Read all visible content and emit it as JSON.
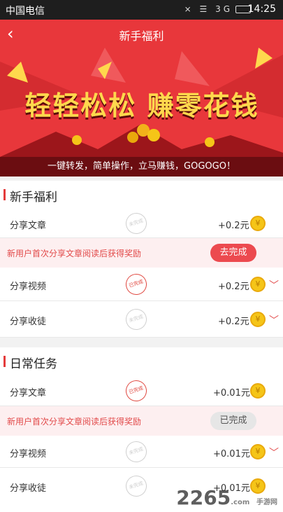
{
  "status": {
    "carrier": "中国电信",
    "icons": "⨯ ☰ 3G",
    "time": "14:25"
  },
  "header": {
    "back": "‹",
    "title": "新手福利"
  },
  "banner": {
    "slogan": "轻轻松松 赚零花钱",
    "subline": "一键转发，简单操作，立马赚钱，GOGOGO！"
  },
  "sections": {
    "newbie": {
      "title": "新手福利",
      "rows": [
        {
          "name": "分享文章",
          "reward": "+0.2元",
          "stamp": "未完成"
        },
        {
          "name": "分享视频",
          "reward": "+0.2元",
          "stamp": "已完成"
        },
        {
          "name": "分享收徒",
          "reward": "+0.2元",
          "stamp": "未完成"
        }
      ],
      "tip": {
        "text": "新用户首次分享文章阅读后获得奖励",
        "button": "去完成"
      }
    },
    "daily": {
      "title": "日常任务",
      "rows": [
        {
          "name": "分享文章",
          "reward": "+0.01元",
          "stamp": "已完成"
        },
        {
          "name": "分享视频",
          "reward": "+0.01元",
          "stamp": "未完成"
        },
        {
          "name": "分享收徒",
          "reward": "+0.01元",
          "stamp": "未完成"
        }
      ],
      "tip": {
        "text": "新用户首次分享文章阅读后获得奖励",
        "button": "已完成"
      }
    }
  },
  "coin_symbol": "¥",
  "chevron": "﹀",
  "watermark": {
    "brand": "2265",
    "suffix": ".com",
    "tag": "手游网"
  },
  "colors": {
    "accent": "#e8373b",
    "banner_dark": "#6b0d11",
    "gold": "#ffd84d"
  }
}
